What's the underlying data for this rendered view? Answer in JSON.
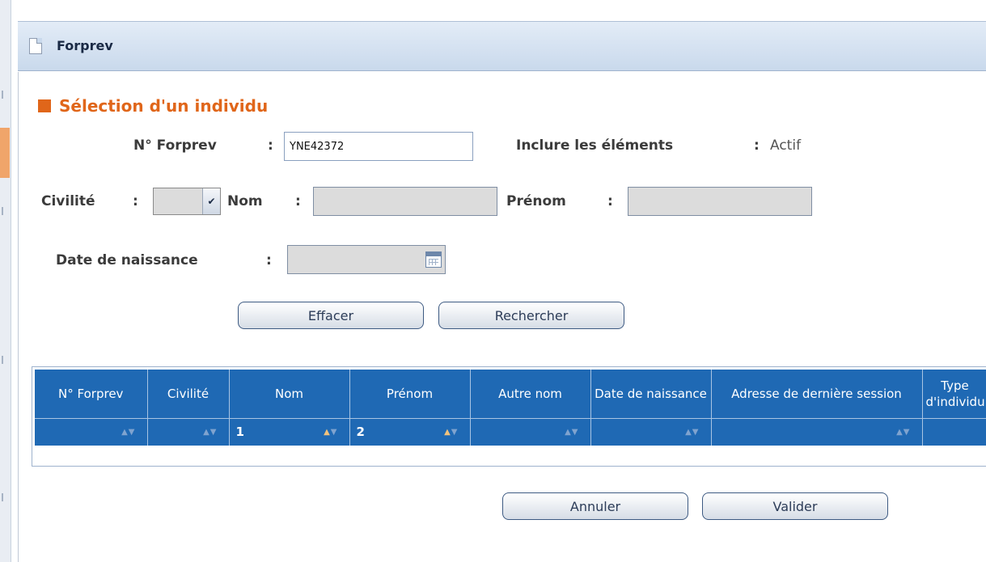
{
  "window": {
    "title": "Forprev"
  },
  "section": {
    "title": "Sélection d'un individu"
  },
  "form": {
    "numero_label": "N° Forprev",
    "numero_value": "YNE42372",
    "separator": ":",
    "inclure_label": "Inclure les éléments",
    "inclure_value": "Actif",
    "civilite_label": "Civilité",
    "civilite_value": "",
    "nom_label": "Nom",
    "nom_value": "",
    "prenom_label": "Prénom",
    "prenom_value": "",
    "date_label": "Date de naissance",
    "date_value": ""
  },
  "buttons": {
    "effacer": "Effacer",
    "rechercher": "Rechercher",
    "annuler": "Annuler",
    "valider": "Valider"
  },
  "grid": {
    "columns": [
      {
        "label": "N° Forprev",
        "filter": "",
        "sort_active": false
      },
      {
        "label": "Civilité",
        "filter": "",
        "sort_active": false
      },
      {
        "label": "Nom",
        "filter": "1",
        "sort_active": true
      },
      {
        "label": "Prénom",
        "filter": "2",
        "sort_active": true
      },
      {
        "label": "Autre nom",
        "filter": "",
        "sort_active": false
      },
      {
        "label": "Date de naissance",
        "filter": "",
        "sort_active": false
      },
      {
        "label": "Adresse de dernière session",
        "filter": "",
        "sort_active": false
      },
      {
        "label": "Type d'individu",
        "filter": "",
        "sort_active": false
      }
    ]
  },
  "icons": {
    "window": "document-icon",
    "dropdown": "chevron-down-icon",
    "calendar": "calendar-icon",
    "sort": "sort-arrows-icon"
  },
  "colors": {
    "accent": "#e0661a",
    "grid_header": "#1f69b4",
    "window_header": "#c9d9ec"
  }
}
